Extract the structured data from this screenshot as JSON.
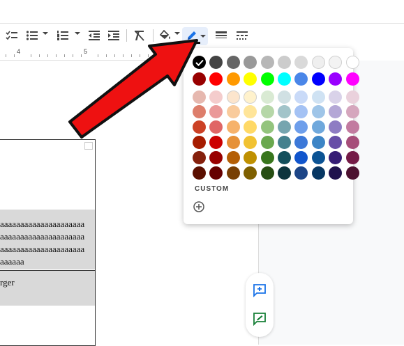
{
  "toolbar": {
    "icons": [
      "checklist-icon",
      "bulleted-list-icon",
      "numbered-list-icon",
      "decrease-indent-icon",
      "increase-indent-icon",
      "clear-formatting-icon",
      "paint-bucket-icon",
      "pen-icon",
      "border-width-icon",
      "border-dash-icon"
    ]
  },
  "ruler": {
    "marks": [
      "4",
      "5"
    ]
  },
  "document": {
    "row_text": "aaaaaaaaaaaaaaaaaaaaa\naaaaaaaaaaaaaaaaaaaaa\naaaaaaaaaaaaaaaaaaaaa\naaaaaa",
    "row2_text": "rger"
  },
  "palette": {
    "selected_color": "#000000",
    "rows": [
      [
        "#000000",
        "#434343",
        "#666666",
        "#999999",
        "#b7b7b7",
        "#cccccc",
        "#d9d9d9",
        "#efefef",
        "#f3f3f3",
        "#ffffff"
      ],
      [
        "#980000",
        "#ff0000",
        "#ff9900",
        "#ffff00",
        "#00ff00",
        "#00ffff",
        "#4a86e8",
        "#0000ff",
        "#9900ff",
        "#ff00ff"
      ],
      [
        "#e6b8af",
        "#f4cccc",
        "#fce5cd",
        "#fff2cc",
        "#d9ead3",
        "#d0e0e3",
        "#c9daf8",
        "#cfe2f3",
        "#d9d2e9",
        "#ead1dc"
      ],
      [
        "#dd7e6b",
        "#ea9999",
        "#f9cb9c",
        "#ffe599",
        "#b6d7a8",
        "#a2c4c9",
        "#a4c2f4",
        "#9fc5e8",
        "#b4a7d6",
        "#d5a6bd"
      ],
      [
        "#cc4125",
        "#e06666",
        "#f6b26b",
        "#ffd966",
        "#93c47d",
        "#76a5af",
        "#6d9eeb",
        "#6fa8dc",
        "#8e7cc3",
        "#c27ba0"
      ],
      [
        "#a61c00",
        "#cc0000",
        "#e69138",
        "#f1c232",
        "#6aa84f",
        "#45818e",
        "#3c78d8",
        "#3d85c6",
        "#674ea7",
        "#a64d79"
      ],
      [
        "#85200c",
        "#990000",
        "#b45f06",
        "#bf9000",
        "#38761d",
        "#134f5c",
        "#1155cc",
        "#0b5394",
        "#351c75",
        "#741b47"
      ],
      [
        "#5b0f00",
        "#660000",
        "#783f04",
        "#7f6000",
        "#274e13",
        "#0c343d",
        "#1c4587",
        "#073763",
        "#20124d",
        "#4c1130"
      ]
    ],
    "custom_label": "CUSTOM",
    "add_custom_icon": "plus-circle-icon"
  },
  "side_buttons": [
    "add-comment-icon",
    "suggest-edit-icon"
  ],
  "colors": {
    "arrow_red": "#ee1111",
    "accent_blue": "#1a73e8"
  }
}
